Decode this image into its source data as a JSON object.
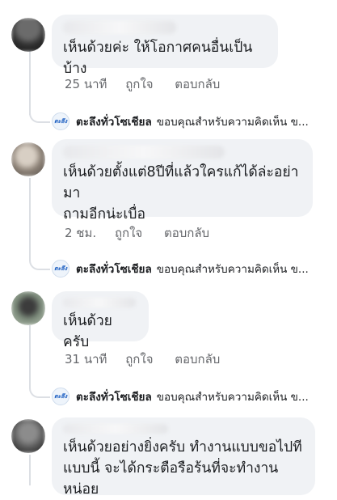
{
  "comments": [
    {
      "text_lines": [
        "เห็นด้วยค่ะ ให้โอกาศคนอื่นเป็นบ้าง"
      ],
      "time": "25 นาที",
      "like": "ถูกใจ",
      "reply": "ตอบกลับ"
    },
    {
      "text_lines": [
        "เห็นด้วยตั้งแต่8ปีที่แล้วใครแก้ได้ล่ะอย่ามา",
        "ถามอีกน่ะเบื่อ"
      ],
      "time": "2 ชม.",
      "like": "ถูกใจ",
      "reply": "ตอบกลับ"
    },
    {
      "text_lines": [
        "เห็นด้วยครับ"
      ],
      "time": "31 นาที",
      "like": "ถูกใจ",
      "reply": "ตอบกลับ"
    },
    {
      "text_lines": [
        "เห็นด้วยอย่างยิ่งครับ ทำงานแบบขอไปที",
        "แบบนี้ จะได้กระตือรือร้นที่จะทำงานหน่อย"
      ]
    }
  ],
  "page_reply": {
    "icon_text": "ตะลึง",
    "author": "ตะลึงทั่วโซเชียล",
    "text": "ขอบคุณสำหรับความคิดเห็น ข..."
  },
  "colors": {
    "bubble": "#f0f2f5",
    "meta": "#65676b",
    "icon_brand": "#1d5fc2"
  }
}
